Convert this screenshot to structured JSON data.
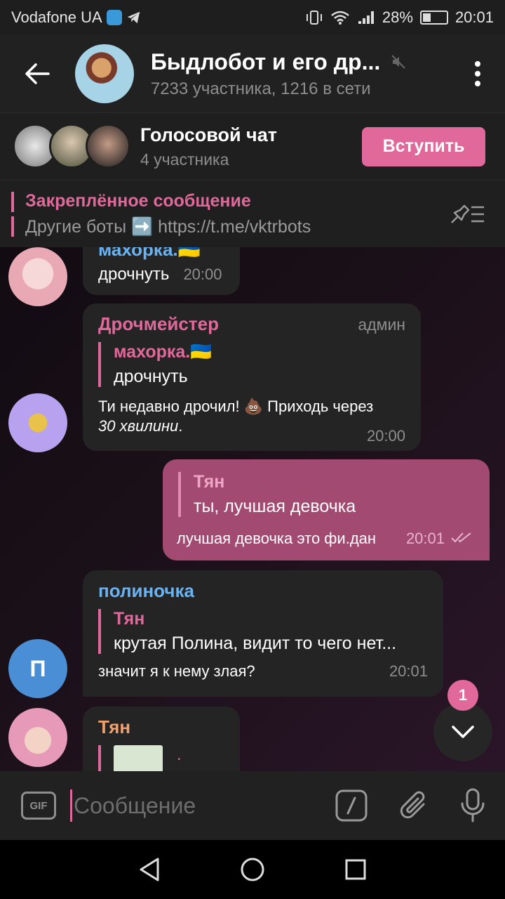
{
  "status": {
    "carrier": "Vodafone UA",
    "battery": "28%",
    "time": "20:01"
  },
  "header": {
    "title": "Быдлобот и его др...",
    "subtitle": "7233 участника, 1216 в сети"
  },
  "voice_chat": {
    "title": "Голосовой чат",
    "participants": "4 участника",
    "join_label": "Вступить"
  },
  "pinned": {
    "title": "Закреплённое сообщение",
    "text": "Другие боты ➡️ https://t.me/vktrbots"
  },
  "messages": [
    {
      "sender": "махорка.🇺🇦",
      "text": "дрочнуть",
      "time": "20:00"
    },
    {
      "sender": "Дрочмейстер",
      "role": "админ",
      "reply_name": "махорка.🇺🇦",
      "reply_text": "дрочнуть",
      "text_main": "Ти недавно дрочил! 💩 Приходь через",
      "text_italic": "30 хвилини",
      "text_end": ".",
      "time": "20:00"
    },
    {
      "reply_name": "Тян",
      "reply_text": "ты, лучшая девочка",
      "text": "лучшая девочка это фи.дан",
      "time": "20:01"
    },
    {
      "sender": "полиночка",
      "reply_name": "Тян",
      "reply_text": "крутая Полина, видит то чего нет...",
      "text": "значит я к нему злая?",
      "time": "20:01",
      "avatar_letter": "П"
    },
    {
      "sender": "Тян"
    }
  ],
  "scroll": {
    "unread": "1"
  },
  "composer": {
    "placeholder": "Сообщение",
    "gif_label": "GIF"
  },
  "colors": {
    "accent": "#e0689a",
    "outgoing_bubble": "#a34a73",
    "incoming_bubble": "#242424",
    "name_blue": "#6ab3f3",
    "name_pink": "#e0689a",
    "name_orange": "#f0a06a"
  }
}
